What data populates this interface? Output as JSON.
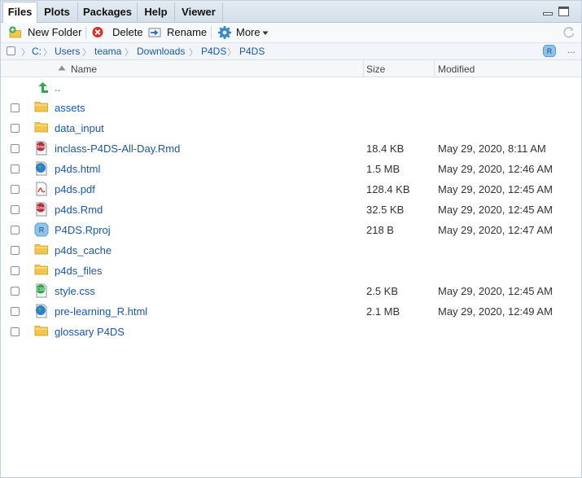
{
  "tabs": [
    {
      "label": "Files",
      "active": true
    },
    {
      "label": "Plots",
      "active": false
    },
    {
      "label": "Packages",
      "active": false
    },
    {
      "label": "Help",
      "active": false
    },
    {
      "label": "Viewer",
      "active": false
    }
  ],
  "toolbar": {
    "new_folder": "New Folder",
    "delete": "Delete",
    "rename": "Rename",
    "more": "More"
  },
  "breadcrumb": [
    "C:",
    "Users",
    "teama",
    "Downloads",
    "P4DS",
    "P4DS"
  ],
  "breadcrumb_more": "...",
  "columns": {
    "name": "Name",
    "size": "Size",
    "modified": "Modified"
  },
  "files": [
    {
      "name": "..",
      "type": "up",
      "size": "",
      "modified": ""
    },
    {
      "name": "assets",
      "type": "folder",
      "size": "",
      "modified": ""
    },
    {
      "name": "data_input",
      "type": "folder",
      "size": "",
      "modified": ""
    },
    {
      "name": "inclass-P4DS-All-Day.Rmd",
      "type": "rmd",
      "size": "18.4 KB",
      "modified": "May 29, 2020, 8:11 AM"
    },
    {
      "name": "p4ds.html",
      "type": "html",
      "size": "1.5 MB",
      "modified": "May 29, 2020, 12:46 AM"
    },
    {
      "name": "p4ds.pdf",
      "type": "pdf",
      "size": "128.4 KB",
      "modified": "May 29, 2020, 12:45 AM"
    },
    {
      "name": "p4ds.Rmd",
      "type": "rmd",
      "size": "32.5 KB",
      "modified": "May 29, 2020, 12:45 AM"
    },
    {
      "name": "P4DS.Rproj",
      "type": "rproj",
      "size": "218 B",
      "modified": "May 29, 2020, 12:47 AM"
    },
    {
      "name": "p4ds_cache",
      "type": "folder",
      "size": "",
      "modified": ""
    },
    {
      "name": "p4ds_files",
      "type": "folder",
      "size": "",
      "modified": ""
    },
    {
      "name": "style.css",
      "type": "css",
      "size": "2.5 KB",
      "modified": "May 29, 2020, 12:45 AM"
    },
    {
      "name": "pre-learning_R.html",
      "type": "html",
      "size": "2.1 MB",
      "modified": "May 29, 2020, 12:49 AM"
    },
    {
      "name": "glossary P4DS",
      "type": "folder",
      "size": "",
      "modified": ""
    }
  ],
  "colors": {
    "link": "#1a57a8",
    "tabbar": "#d4dfea",
    "folder": "#f3c64a",
    "up_arrow": "#2fa84f"
  }
}
